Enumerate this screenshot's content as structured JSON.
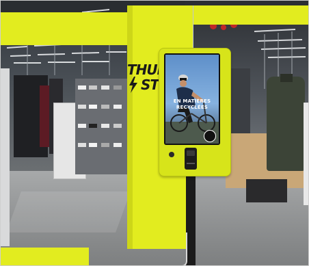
{
  "store": {
    "sign_text_line1": "THUND",
    "sign_text_line2": "STO",
    "palette": {
      "frame_yellow": "#e2ec1f",
      "ceiling": "#2a2d31",
      "floor": "#8d8f90",
      "kiosk_body": "#d7e41a",
      "kiosk_dark": "#1c1c1c",
      "screen_sky": "#6f9ed4"
    }
  },
  "kiosk": {
    "screen_headline_line1": "EN MATIÈRES",
    "screen_headline_line2": "RECYCLÉES",
    "logo_icon": "brand-logo-icon",
    "payment_icon": "card-terminal-icon"
  }
}
